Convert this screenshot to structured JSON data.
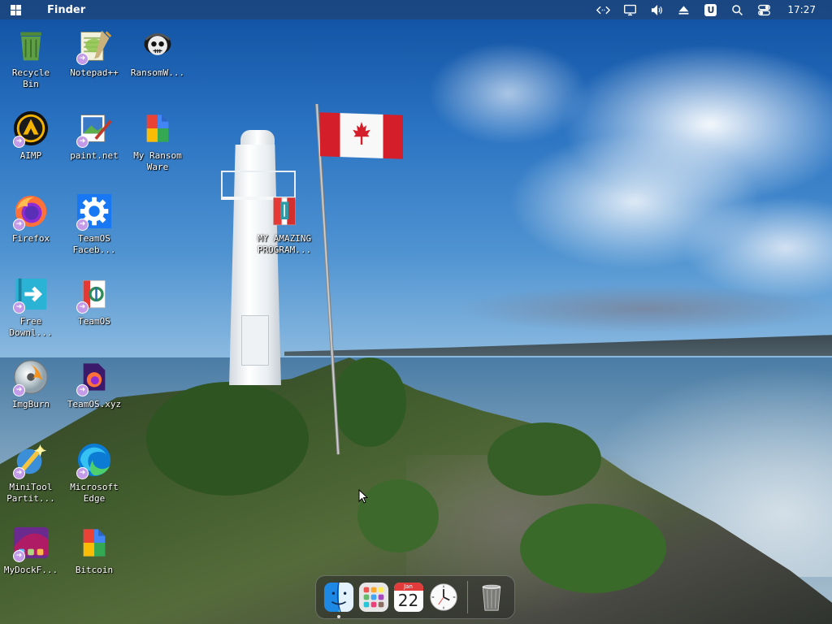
{
  "topbar": {
    "app_name": "Finder",
    "clock": "17:27",
    "tray_icons": [
      "code-icon",
      "display-icon",
      "volume-icon",
      "eject-icon",
      "user-badge-icon",
      "search-icon",
      "control-center-icon"
    ],
    "user_badge_letter": "U"
  },
  "desktop": {
    "icons": [
      {
        "label": "Recycle\nBin",
        "icon": "recycle-bin-icon"
      },
      {
        "label": "Notepad++",
        "icon": "notepad-plus-plus-icon"
      },
      {
        "label": "RansomW...",
        "icon": "skull-icon"
      },
      {
        "label": "AIMP",
        "icon": "aimp-icon"
      },
      {
        "label": "paint.net",
        "icon": "paint-net-icon"
      },
      {
        "label": "My Ransom\nWare",
        "icon": "colored-file-icon"
      },
      {
        "label": "Firefox",
        "icon": "firefox-icon"
      },
      {
        "label": "TeamOS\nFaceb...",
        "icon": "gear-icon"
      },
      {
        "label": "MY AMAZING\nPROGRAM...",
        "icon": "program-icon"
      },
      {
        "label": "Free\nDownl...",
        "icon": "download-manager-icon"
      },
      {
        "label": "TeamOS",
        "icon": "teamos-icon"
      },
      {
        "label": "ImgBurn",
        "icon": "disc-icon"
      },
      {
        "label": "TeamOS.xyz",
        "icon": "firefox-document-icon"
      },
      {
        "label": "MiniTool\nPartit...",
        "icon": "minitool-icon"
      },
      {
        "label": "Microsoft\nEdge",
        "icon": "edge-icon"
      },
      {
        "label": "MyDockF...",
        "icon": "mydock-icon"
      },
      {
        "label": "Bitcoin",
        "icon": "colored-file-icon"
      }
    ]
  },
  "dock": {
    "items": [
      "finder-icon",
      "launchpad-icon",
      "calendar-icon",
      "clock-icon",
      "trash-icon"
    ],
    "calendar_month": "Jan",
    "calendar_day": "22"
  },
  "colors": {
    "topbar_bg": "#283c5a",
    "shortcut_badge": "#c39be8",
    "flag_red": "#d41f2a"
  }
}
